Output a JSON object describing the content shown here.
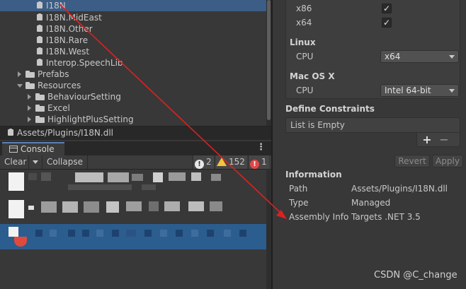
{
  "project_tree": {
    "items": [
      {
        "label": "I18N",
        "kind": "assembly",
        "selected": true
      },
      {
        "label": "I18N.MidEast",
        "kind": "assembly"
      },
      {
        "label": "I18N.Other",
        "kind": "assembly"
      },
      {
        "label": "I18N.Rare",
        "kind": "assembly"
      },
      {
        "label": "I18N.West",
        "kind": "assembly"
      },
      {
        "label": "Interop.SpeechLib",
        "kind": "assembly"
      },
      {
        "label": "Prefabs",
        "kind": "folder",
        "expanded": false
      },
      {
        "label": "Resources",
        "kind": "folder",
        "expanded": true
      },
      {
        "label": "BehaviourSetting",
        "kind": "folder",
        "expanded": false
      },
      {
        "label": "Excel",
        "kind": "folder",
        "expanded": false
      },
      {
        "label": "HighlightPlusSetting",
        "kind": "folder",
        "expanded": false
      }
    ],
    "selected_path": "Assets/Plugins/I18N.dll"
  },
  "console": {
    "tab_label": "Console",
    "toolbar": {
      "clear_label": "Clear",
      "collapse_label": "Collapse",
      "info_count": "2",
      "warning_count": "152",
      "error_count": "1"
    }
  },
  "inspector": {
    "platform_settings": {
      "x86_label": "x86",
      "x86_checked": true,
      "x64_label": "x64",
      "x64_checked": true,
      "linux_header": "Linux",
      "linux_cpu_label": "CPU",
      "linux_cpu_value": "x64",
      "mac_header": "Mac OS X",
      "mac_cpu_label": "CPU",
      "mac_cpu_value": "Intel 64-bit"
    },
    "define_constraints": {
      "header": "Define Constraints",
      "empty_text": "List is Empty",
      "add_label": "+",
      "remove_label": "−"
    },
    "revert_label": "Revert",
    "apply_label": "Apply",
    "information": {
      "header": "Information",
      "rows": [
        {
          "label": "Path",
          "value": "Assets/Plugins/I18N.dll"
        },
        {
          "label": "Type",
          "value": "Managed"
        },
        {
          "label": "Assembly Info",
          "value": "Targets .NET 3.5"
        }
      ]
    }
  },
  "watermark": "CSDN @C_change",
  "colors": {
    "selection_blue": "#3c5d86",
    "annotation_red": "#e02020",
    "error_red": "#e24848",
    "warning_yellow": "#f3c43a"
  }
}
